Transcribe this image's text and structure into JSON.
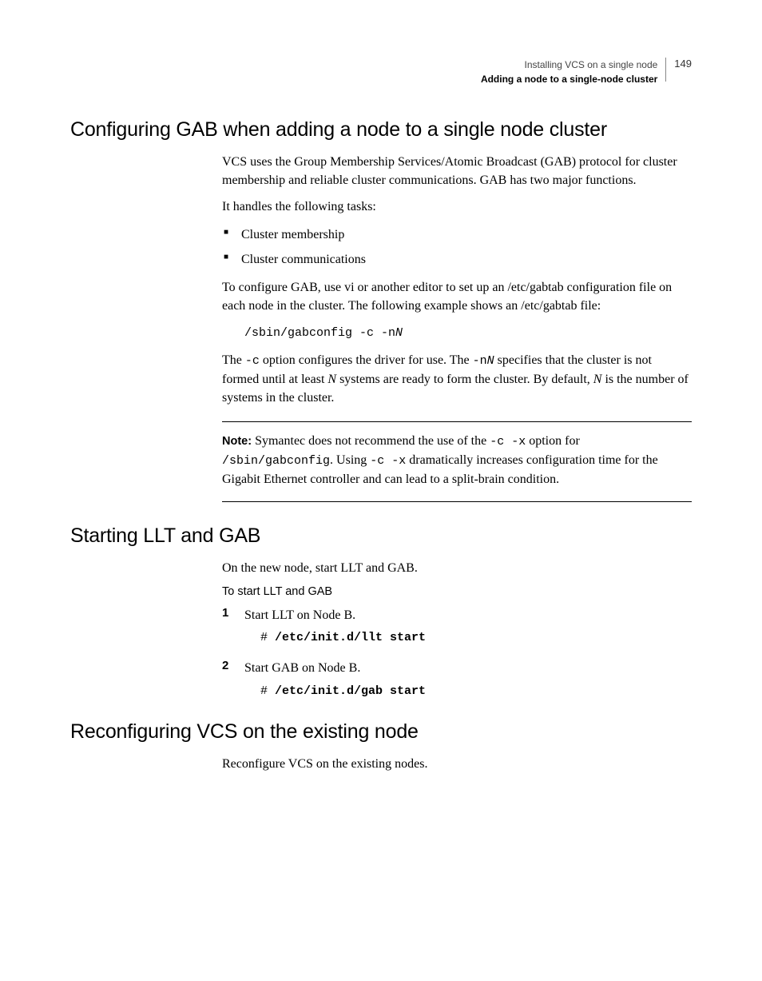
{
  "header": {
    "line1": "Installing VCS on a single node",
    "line2": "Adding a node to a single-node cluster",
    "page": "149"
  },
  "section1": {
    "title": "Configuring GAB when adding a node to a single node cluster",
    "p1": "VCS uses the Group Membership Services/Atomic Broadcast (GAB) protocol for cluster membership and reliable cluster communications. GAB has two major functions.",
    "p2": "It handles the following tasks:",
    "bullets": [
      "Cluster membership",
      "Cluster communications"
    ],
    "p3": "To configure GAB, use vi or another editor to set up an /etc/gabtab configuration file on each node in the cluster. The following example shows an /etc/gabtab file:",
    "code1_a": "/sbin/gabconfig -c -n",
    "code1_b": "N",
    "p4_a": "The ",
    "p4_b": "-c",
    "p4_c": " option configures the driver for use. The ",
    "p4_d": "-n",
    "p4_e": "N",
    "p4_f": " specifies that the cluster is not formed until at least ",
    "p4_g": "N",
    "p4_h": " systems are ready to form the cluster. By default, ",
    "p4_i": "N",
    "p4_j": " is the number of systems in the cluster.",
    "note": {
      "label": "Note:",
      "p1_a": " Symantec does not recommend the use of the ",
      "p1_b": "-c -x",
      "p1_c": " option for ",
      "p2_a": "/sbin/gabconfig",
      "p2_b": ". Using ",
      "p2_c": "-c -x",
      "p2_d": " dramatically increases configuration time for the Gigabit Ethernet controller and can lead to a split-brain condition."
    }
  },
  "section2": {
    "title": "Starting LLT and GAB",
    "p1": "On the new node, start LLT and GAB.",
    "sub": "To start LLT and GAB",
    "steps": [
      {
        "num": "1",
        "text": "Start LLT on Node B.",
        "prompt": "# ",
        "cmd": "/etc/init.d/llt start"
      },
      {
        "num": "2",
        "text": "Start GAB on Node B.",
        "prompt": "# ",
        "cmd": "/etc/init.d/gab start"
      }
    ]
  },
  "section3": {
    "title": "Reconfiguring VCS on the existing node",
    "p1": "Reconfigure VCS on the existing nodes."
  }
}
